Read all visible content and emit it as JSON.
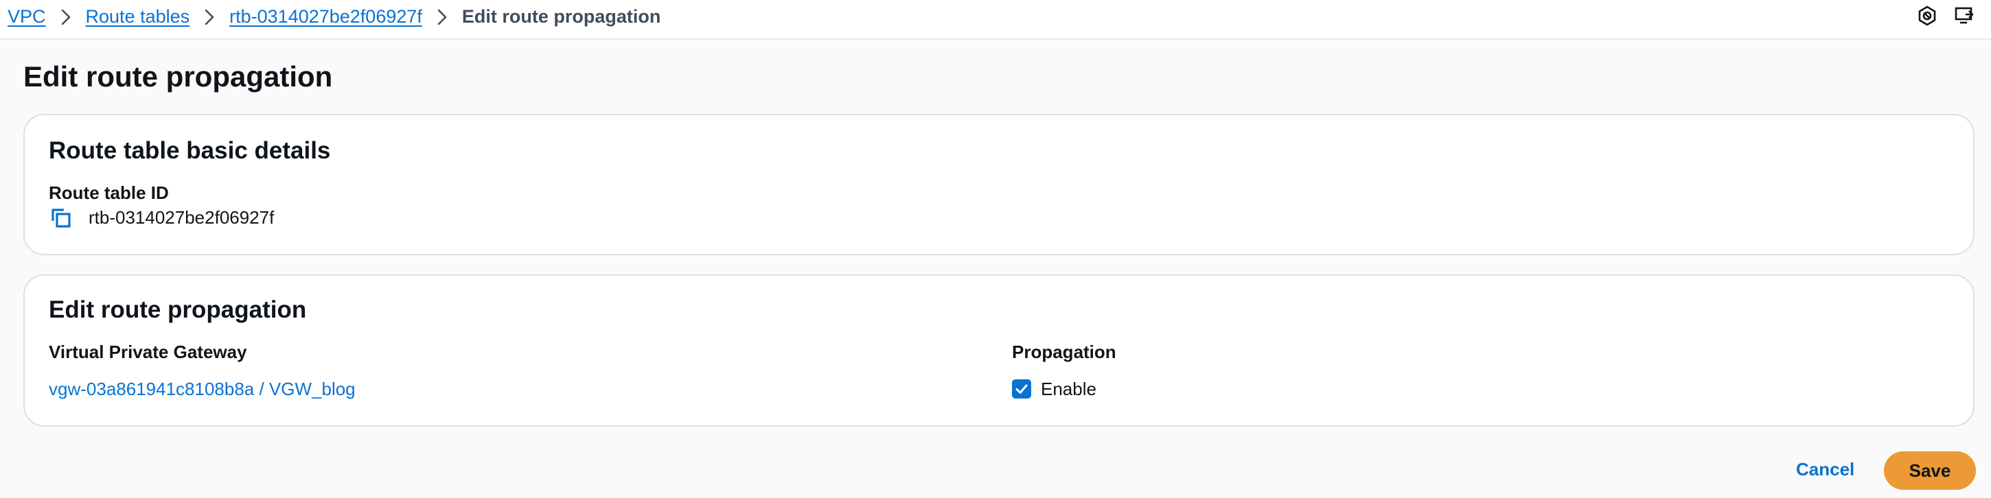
{
  "breadcrumb": {
    "items": [
      {
        "label": "VPC"
      },
      {
        "label": "Route tables"
      },
      {
        "label": "rtb-0314027be2f06927f"
      }
    ],
    "current": "Edit route propagation"
  },
  "header_icons": [
    "settings-hexagon-icon",
    "screen-share-icon"
  ],
  "page": {
    "title": "Edit route propagation"
  },
  "basic_details": {
    "title": "Route table basic details",
    "id_label": "Route table ID",
    "id_value": "rtb-0314027be2f06927f",
    "copy_icon": "copy-icon"
  },
  "propagation": {
    "title": "Edit route propagation",
    "gateway_header": "Virtual Private Gateway",
    "propagation_header": "Propagation",
    "rows": [
      {
        "gateway": "vgw-03a861941c8108b8a / VGW_blog",
        "checkbox_label": "Enable",
        "checked": true
      }
    ]
  },
  "actions": {
    "cancel": "Cancel",
    "save": "Save"
  },
  "colors": {
    "link": "#0972d3",
    "primary_button": "#ec9a35",
    "text": "#0f141a",
    "muted_text": "#414d5c",
    "border": "#dddfe2",
    "page_bg": "#fafafa"
  }
}
